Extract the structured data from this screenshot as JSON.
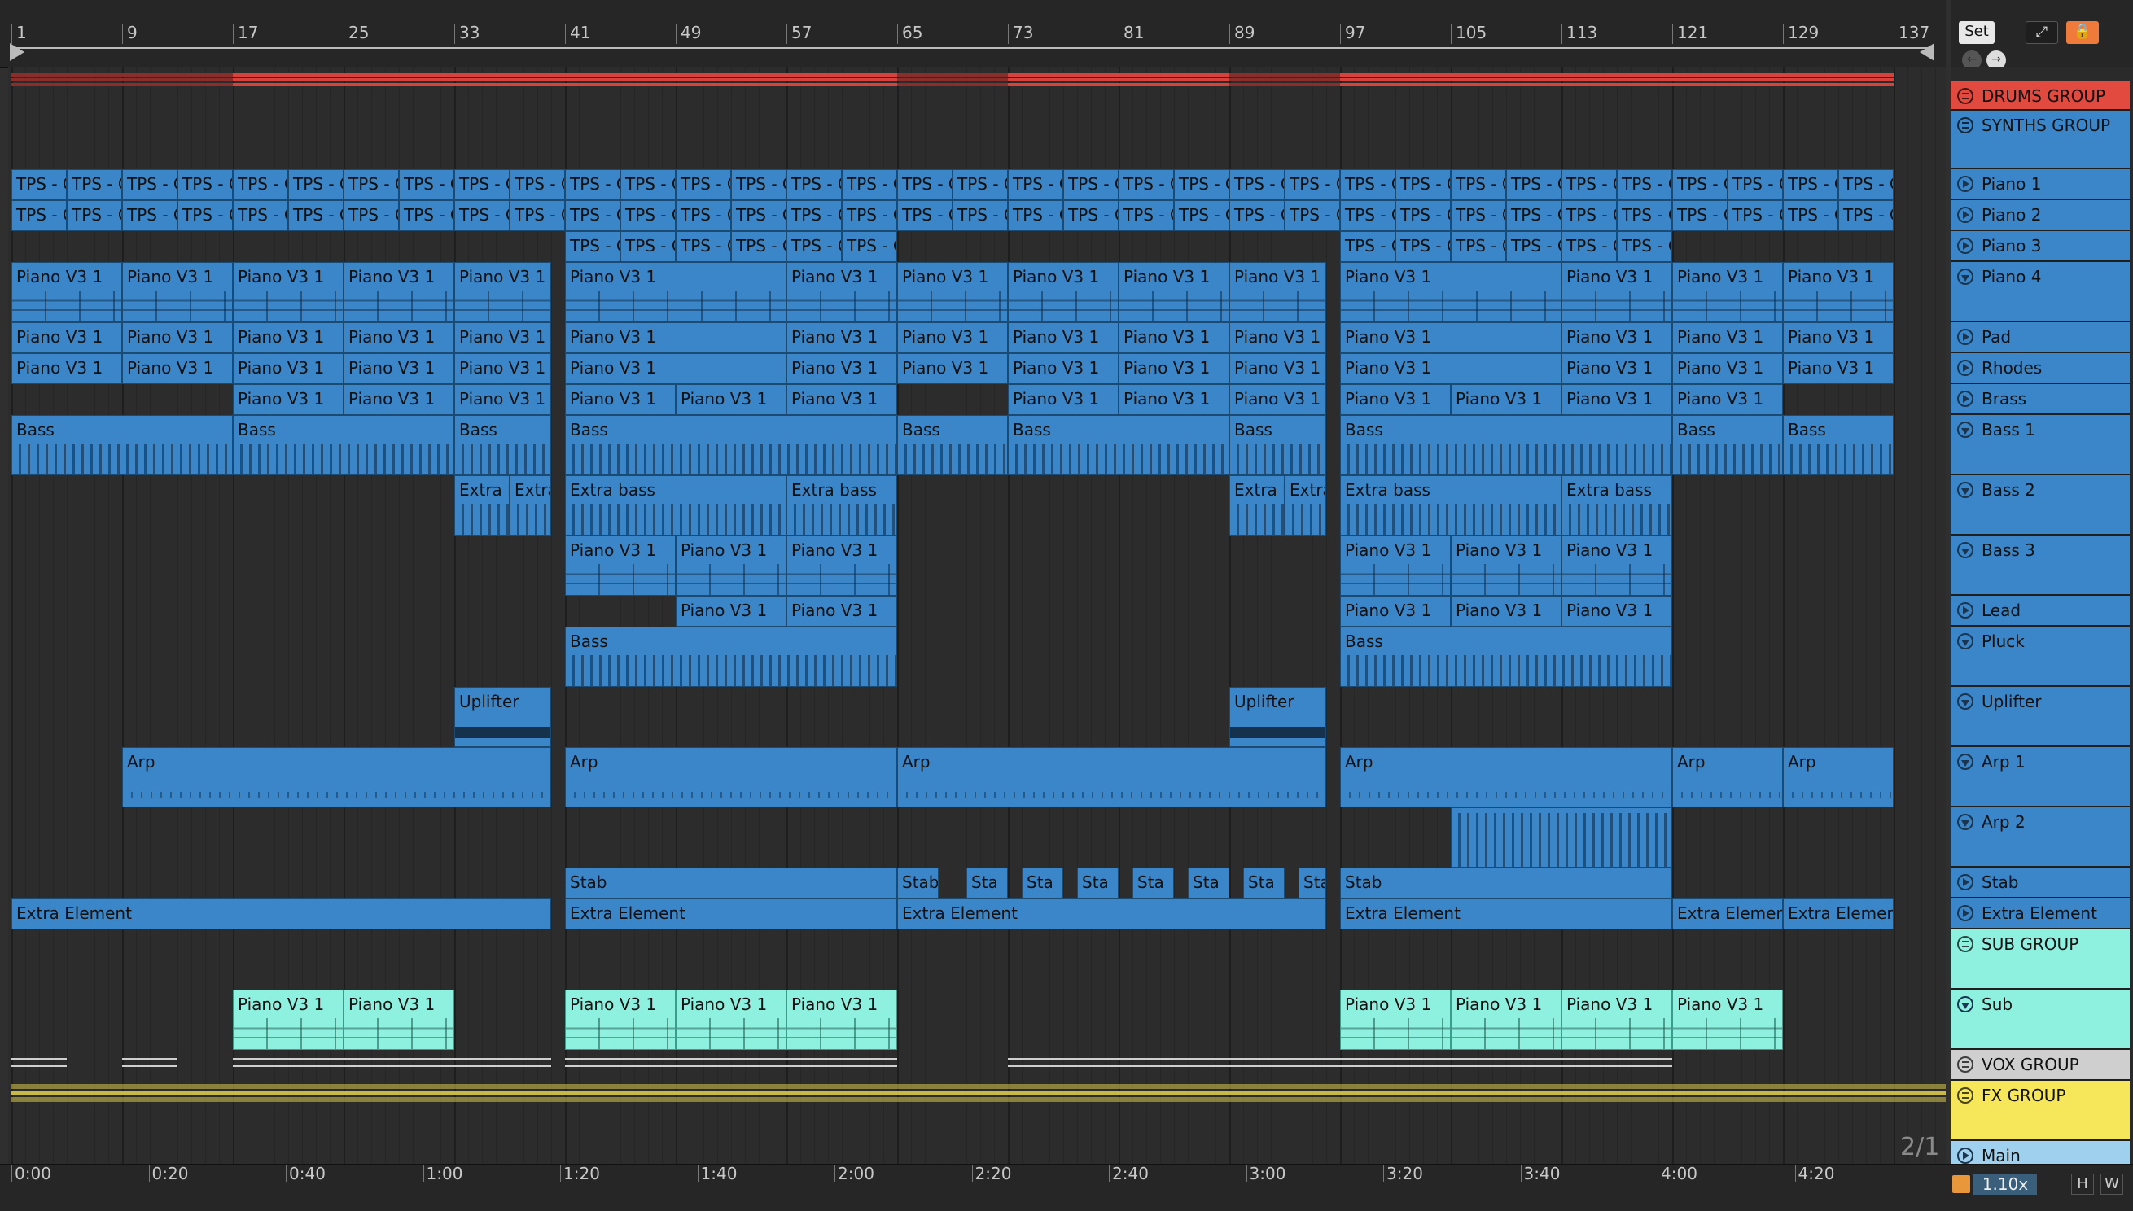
{
  "ruler": {
    "bars": [
      "1",
      "9",
      "17",
      "25",
      "33",
      "41",
      "49",
      "57",
      "65",
      "73",
      "81",
      "89",
      "97",
      "105",
      "113",
      "121",
      "129",
      "137"
    ]
  },
  "top_controls": {
    "set_label": "Set",
    "expand_icon": "expand-icon",
    "lock_icon": "lock-icon",
    "back_icon": "back-arrow-icon",
    "forward_icon": "forward-arrow-icon"
  },
  "tracks": [
    {
      "label": "DRUMS GROUP",
      "kind": "group",
      "color": "red"
    },
    {
      "label": "SYNTHS GROUP",
      "kind": "group",
      "color": "blue"
    },
    {
      "label": "Piano 1",
      "kind": "play",
      "color": "blue"
    },
    {
      "label": "Piano 2",
      "kind": "play",
      "color": "blue"
    },
    {
      "label": "Piano 3",
      "kind": "play",
      "color": "blue"
    },
    {
      "label": "Piano 4",
      "kind": "fold",
      "color": "blue"
    },
    {
      "label": "Pad",
      "kind": "play",
      "color": "blue"
    },
    {
      "label": "Rhodes",
      "kind": "play",
      "color": "blue"
    },
    {
      "label": "Brass",
      "kind": "play",
      "color": "blue"
    },
    {
      "label": "Bass 1",
      "kind": "fold",
      "color": "blue"
    },
    {
      "label": "Bass 2",
      "kind": "fold",
      "color": "blue"
    },
    {
      "label": "Bass 3",
      "kind": "fold",
      "color": "blue"
    },
    {
      "label": "Lead",
      "kind": "play",
      "color": "blue"
    },
    {
      "label": "Pluck",
      "kind": "fold",
      "color": "blue"
    },
    {
      "label": "Uplifter",
      "kind": "fold",
      "color": "blue"
    },
    {
      "label": "Arp 1",
      "kind": "fold",
      "color": "blue"
    },
    {
      "label": "Arp 2",
      "kind": "fold",
      "color": "blue"
    },
    {
      "label": "Stab",
      "kind": "play",
      "color": "blue"
    },
    {
      "label": "Extra Element",
      "kind": "play",
      "color": "blue"
    },
    {
      "label": "SUB GROUP",
      "kind": "group",
      "color": "teal"
    },
    {
      "label": "Sub",
      "kind": "fold",
      "color": "teal"
    },
    {
      "label": "VOX GROUP",
      "kind": "group",
      "color": "grey"
    },
    {
      "label": "FX GROUP",
      "kind": "group",
      "color": "yellow"
    },
    {
      "label": "Main",
      "kind": "play",
      "color": "main"
    }
  ],
  "clip_names": {
    "tps": "TPS - C",
    "piano": "Piano V3 1",
    "bass": "Bass",
    "extra_bass": "Extra bass",
    "extra_short": "Extra b",
    "extra_short2": "Extra",
    "uplifter": "Uplifter",
    "arp": "Arp",
    "stab": "Stab",
    "stab_short": "Sta",
    "extra_element": "Extra Element",
    "extra_elemen": "Extra Elemen"
  },
  "timeline": {
    "labels": [
      "0:00",
      "0:20",
      "0:40",
      "1:00",
      "1:20",
      "1:40",
      "2:00",
      "2:20",
      "2:40",
      "3:00",
      "3:20",
      "3:40",
      "4:00",
      "4:20"
    ]
  },
  "footer": {
    "signature": "2/1",
    "zoom": "1.10x",
    "h_label": "H",
    "w_label": "W",
    "cpu_icon": "cpu-meter-icon"
  },
  "colors": {
    "blue": "#3a86c8",
    "red": "#e24a40",
    "teal": "#8ef0de",
    "grey": "#cfcfcf",
    "yellow": "#f5e65a",
    "main": "#9fd0ee"
  }
}
